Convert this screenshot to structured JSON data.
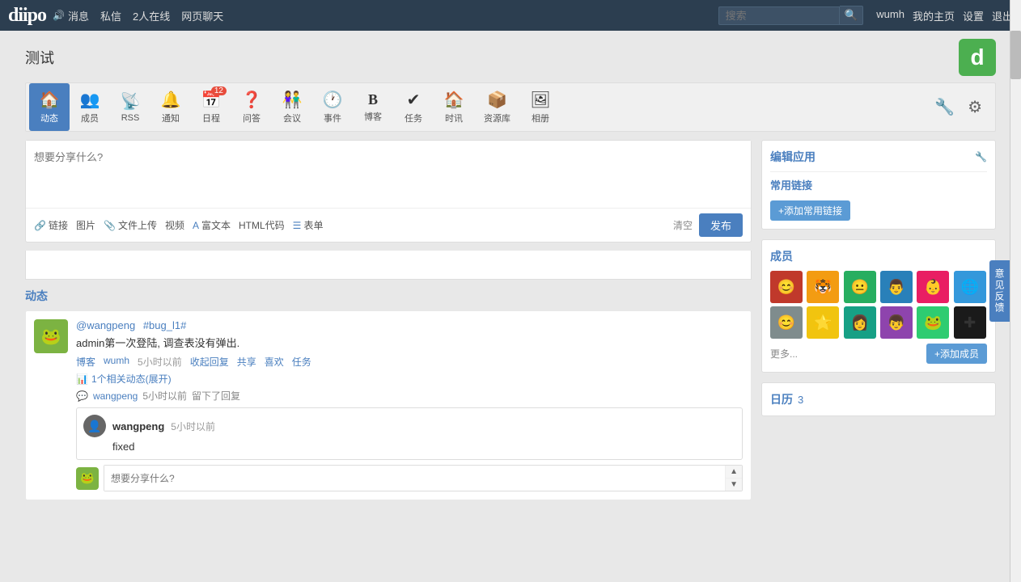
{
  "topnav": {
    "logo": "diipo",
    "sound_label": "消息",
    "private_label": "私信",
    "online_label": "2人在线",
    "webchat_label": "网页聊天",
    "search_placeholder": "搜索",
    "user_name": "wumh",
    "my_home_label": "我的主页",
    "settings_label": "设置",
    "logout_label": "退出"
  },
  "page": {
    "title": "测试",
    "app_icon": "d"
  },
  "tabs": [
    {
      "id": "activity",
      "label": "动态",
      "icon": "🏠",
      "active": true
    },
    {
      "id": "members",
      "label": "成员",
      "icon": "👥",
      "active": false
    },
    {
      "id": "rss",
      "label": "RSS",
      "icon": "📡",
      "active": false
    },
    {
      "id": "notify",
      "label": "通知",
      "icon": "🔔",
      "active": false
    },
    {
      "id": "calendar",
      "label": "日程",
      "icon": "📅",
      "badge": "12",
      "active": false
    },
    {
      "id": "qa",
      "label": "问答",
      "icon": "❓",
      "active": false
    },
    {
      "id": "meeting",
      "label": "会议",
      "icon": "👫",
      "active": false
    },
    {
      "id": "events",
      "label": "事件",
      "icon": "🕐",
      "active": false
    },
    {
      "id": "blog",
      "label": "博客",
      "icon": "B",
      "active": false
    },
    {
      "id": "tasks",
      "label": "任务",
      "icon": "✔",
      "active": false
    },
    {
      "id": "news",
      "label": "时讯",
      "icon": "🏠",
      "active": false
    },
    {
      "id": "resources",
      "label": "资源库",
      "icon": "📦",
      "active": false
    },
    {
      "id": "album",
      "label": "相册",
      "icon": "🖼",
      "active": false
    }
  ],
  "post_box": {
    "placeholder": "想要分享什么?",
    "toolbar": {
      "link_label": "链接",
      "image_label": "图片",
      "upload_label": "文件上传",
      "video_label": "视频",
      "rich_label": "富文本",
      "html_label": "HTML代码",
      "form_label": "表单"
    },
    "clear_label": "清空",
    "publish_label": "发布"
  },
  "activity_section": {
    "title": "动态",
    "items": [
      {
        "user": "@wangpeng",
        "tag": "#bug_l1#",
        "content": "admin第一次登陆, 调查表没有弹出.",
        "source": "博客",
        "source_user": "wumh",
        "time": "5小时以前",
        "actions": [
          "收起回复",
          "共享",
          "喜欢",
          "任务"
        ],
        "related": "1个相关动态(展开)",
        "reply_user": "wangpeng",
        "reply_time": "5小时以前",
        "reply_suffix": "留下了回复",
        "reply_content": "fixed",
        "reply_content_user": "wangpeng",
        "reply_content_time": "5小时以前",
        "reply_input_placeholder": "想要分享什么?"
      }
    ]
  },
  "sidebar": {
    "edit_app_label": "编辑应用",
    "quick_links_title": "常用链接",
    "add_link_label": "+添加常用链接",
    "members_title": "成员",
    "more_label": "更多...",
    "add_member_label": "+添加成员",
    "calendar_title": "日历",
    "calendar_count": "3",
    "member_avatars": [
      {
        "color": "#c0392b",
        "icon": "😊"
      },
      {
        "color": "#f39c12",
        "icon": "🐯"
      },
      {
        "color": "#27ae60",
        "icon": "😐"
      },
      {
        "color": "#2980b9",
        "icon": "👨"
      },
      {
        "color": "#e91e63",
        "icon": "👶"
      },
      {
        "color": "#3498db",
        "icon": "🌐"
      },
      {
        "color": "#7f8c8d",
        "icon": "😊"
      },
      {
        "color": "#f1c40f",
        "icon": "🌟"
      },
      {
        "color": "#16a085",
        "icon": "👩"
      },
      {
        "color": "#8e44ad",
        "icon": "👦"
      },
      {
        "color": "#2ecc71",
        "icon": "🐸"
      },
      {
        "color": "#1a1a1a",
        "icon": "✚"
      }
    ]
  },
  "feedback_tab": "意见反馈"
}
